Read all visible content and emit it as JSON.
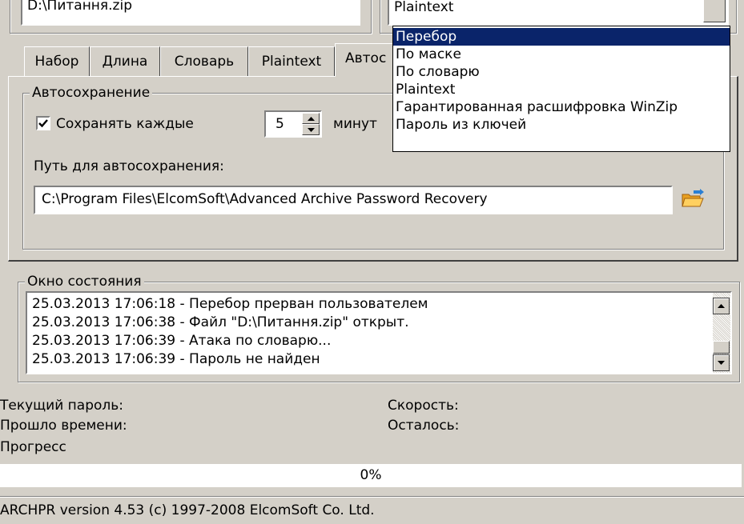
{
  "file_field": {
    "value": "D:\\Питання.zip"
  },
  "attack_select": {
    "value": "Plaintext"
  },
  "attack_dropdown": {
    "items": [
      "Перебор",
      "По маске",
      "По словарю",
      "Plaintext",
      "Гарантированная расшифровка WinZip",
      "Пароль из ключей"
    ],
    "selected_index": 0
  },
  "tabs": [
    {
      "label": "Набор"
    },
    {
      "label": "Длина"
    },
    {
      "label": "Словарь"
    },
    {
      "label": "Plaintext"
    },
    {
      "label": "Автос"
    }
  ],
  "autosave": {
    "group_title": "Автосохранение",
    "checkbox_label": "Сохранять каждые",
    "checked": true,
    "minutes_value": "5",
    "minutes_unit": "минут",
    "path_label": "Путь для автосохранения:",
    "path_value": "C:\\Program Files\\ElcomSoft\\Advanced Archive Password Recovery"
  },
  "status_window": {
    "title": "Окно состояния",
    "lines": [
      "25.03.2013 17:06:18 - Перебор прерван пользователем",
      "25.03.2013 17:06:38 - Файл \"D:\\Питання.zip\" открыт.",
      "25.03.2013 17:06:39 - Атака по словарю...",
      "25.03.2013 17:06:39 - Пароль не найден"
    ]
  },
  "info": {
    "current_password_label": "Текущий пароль:",
    "speed_label": "Скорость:",
    "elapsed_label": "Прошло времени:",
    "remaining_label": "Осталось:",
    "progress_label": "Прогресс",
    "progress_text": "0%",
    "progress_fraction": 0
  },
  "statusbar": {
    "text": "ARCHPR version 4.53 (c) 1997-2008 ElcomSoft Co. Ltd."
  },
  "colors": {
    "selection": "#0a246a",
    "window": "#d4d0c8",
    "folder_icon": "#f5a623"
  },
  "icons": {
    "folder": "folder-open-icon",
    "check": "check-icon"
  }
}
